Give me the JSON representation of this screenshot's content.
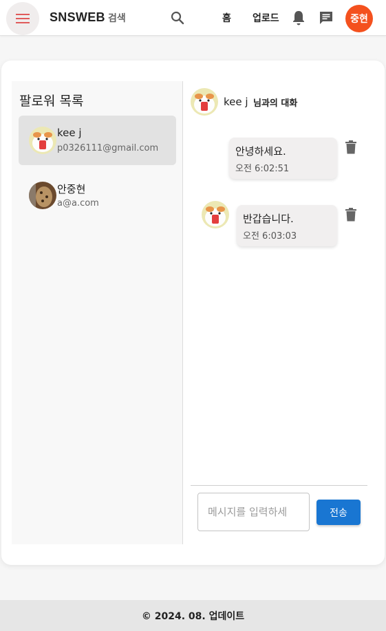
{
  "header": {
    "brand": "SNSWEB",
    "search_label": "검색",
    "nav_home": "홈",
    "nav_upload": "업로드",
    "avatar_initials": "중현",
    "avatar_color": "#f4511e"
  },
  "sidebar": {
    "title": "팔로워 목록",
    "contacts": [
      {
        "name": "kee j",
        "email": "p0326111@gmail.com",
        "selected": true,
        "avatar": "hamster-avatar"
      },
      {
        "name": "안중현",
        "email": "a@a.com",
        "selected": false,
        "avatar": "photo-avatar"
      }
    ]
  },
  "chat": {
    "partner_name": "kee j",
    "subtitle": "님과의 대화",
    "messages": [
      {
        "text": "안녕하세요.",
        "time": "오전 6:02:51",
        "mine": true
      },
      {
        "text": "반갑습니다.",
        "time": "오전 6:03:03",
        "mine": false
      }
    ],
    "input_placeholder": "메시지를 입력하세",
    "send_label": "전송"
  },
  "footer": {
    "text": "© 2024. 08. 업데이트"
  },
  "colors": {
    "accent": "#1976d2",
    "menu_icon": "#e05a5a"
  }
}
